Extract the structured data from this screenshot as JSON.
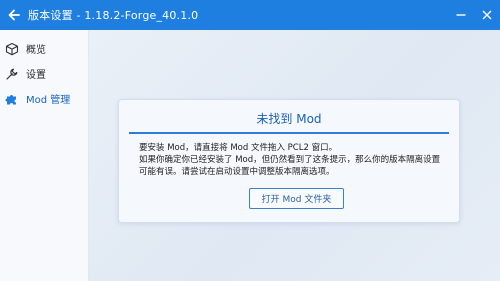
{
  "window": {
    "title": "版本设置 - 1.18.2-Forge_40.1.0",
    "accent_color": "#1e7fe0"
  },
  "titlebar": {
    "back_icon": "arrow-left-icon",
    "minimize_icon": "minimize-icon",
    "close_icon": "close-icon"
  },
  "sidebar": {
    "items": [
      {
        "label": "概览",
        "icon": "cube-icon",
        "active": false
      },
      {
        "label": "设置",
        "icon": "wrench-icon",
        "active": false
      },
      {
        "label": "Mod 管理",
        "icon": "puzzle-icon",
        "active": true
      }
    ]
  },
  "card": {
    "title": "未找到 Mod",
    "lines": [
      "要安装 Mod，请直接将 Mod 文件拖入 PCL2 窗口。",
      "如果你确定你已经安装了 Mod，但仍然看到了这条提示，那么你的版本隔离设置",
      "可能有误。请尝试在启动设置中调整版本隔离选项。"
    ],
    "button_label": "打开 Mod 文件夹"
  }
}
